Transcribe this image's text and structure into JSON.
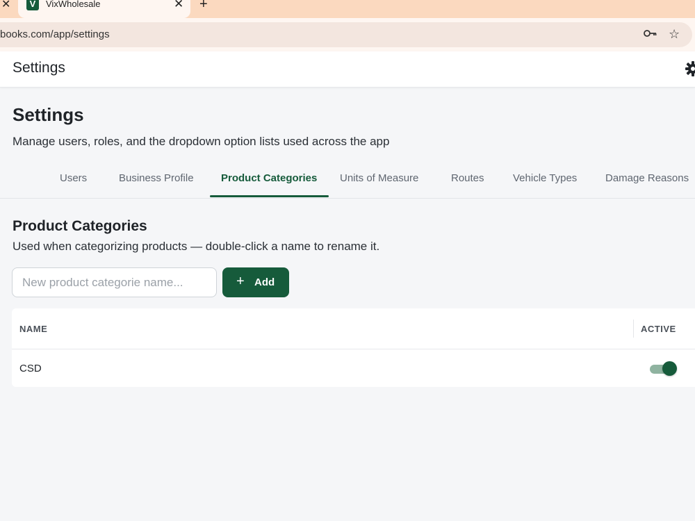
{
  "browser": {
    "tab_title": "VixWholesale",
    "favicon_letter": "V",
    "close_glyph": "✕",
    "new_tab_glyph": "+",
    "url": "books.com/app/settings",
    "star_glyph": "☆"
  },
  "header": {
    "title": "Settings"
  },
  "page": {
    "title": "Settings",
    "subtitle": "Manage users, roles, and the dropdown option lists used across the app"
  },
  "tabs": [
    {
      "label": "Users"
    },
    {
      "label": "Business Profile"
    },
    {
      "label": "Product Categories",
      "active": true
    },
    {
      "label": "Units of Measure"
    },
    {
      "label": "Routes"
    },
    {
      "label": "Vehicle Types"
    },
    {
      "label": "Damage Reasons"
    }
  ],
  "section": {
    "title": "Product Categories",
    "subtitle": "Used when categorizing products — double-click a name to rename it.",
    "input_placeholder": "New product categorie name...",
    "add_glyph": "+",
    "add_label": "Add"
  },
  "table": {
    "columns": [
      "NAME",
      "ACTIVE"
    ],
    "rows": [
      {
        "name": "CSD",
        "active": true
      }
    ]
  },
  "colors": {
    "brand": "#165b3b",
    "tab_bar": "#fbd9bf",
    "toggle_track": "#8fb3a0"
  }
}
